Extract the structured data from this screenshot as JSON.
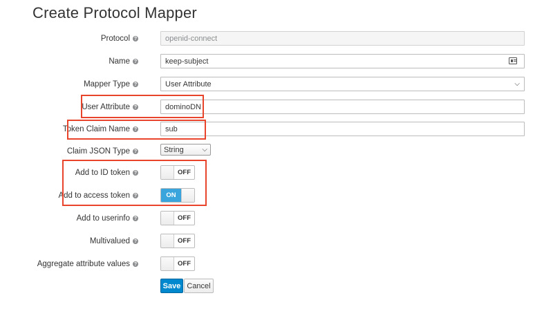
{
  "page": {
    "title": "Create Protocol Mapper"
  },
  "form": {
    "protocol": {
      "label": "Protocol",
      "value": "openid-connect"
    },
    "name": {
      "label": "Name",
      "value": "keep-subject"
    },
    "mapper_type": {
      "label": "Mapper Type",
      "value": "User Attribute"
    },
    "user_attribute": {
      "label": "User Attribute",
      "value": "dominoDN"
    },
    "token_claim_name": {
      "label": "Token Claim Name",
      "value": "sub"
    },
    "claim_json_type": {
      "label": "Claim JSON Type",
      "value": "String"
    },
    "add_to_id_token": {
      "label": "Add to ID token",
      "state": "OFF"
    },
    "add_to_access_token": {
      "label": "Add to access token",
      "state": "ON"
    },
    "add_to_userinfo": {
      "label": "Add to userinfo",
      "state": "OFF"
    },
    "multivalued": {
      "label": "Multivalued",
      "state": "OFF"
    },
    "aggregate_attribute_values": {
      "label": "Aggregate attribute values",
      "state": "OFF"
    }
  },
  "help_glyph": "?",
  "buttons": {
    "save": "Save",
    "cancel": "Cancel"
  },
  "colors": {
    "highlight": "#e8442c",
    "toggle_on": "#39a5dc",
    "save_button": "#0088ce"
  }
}
